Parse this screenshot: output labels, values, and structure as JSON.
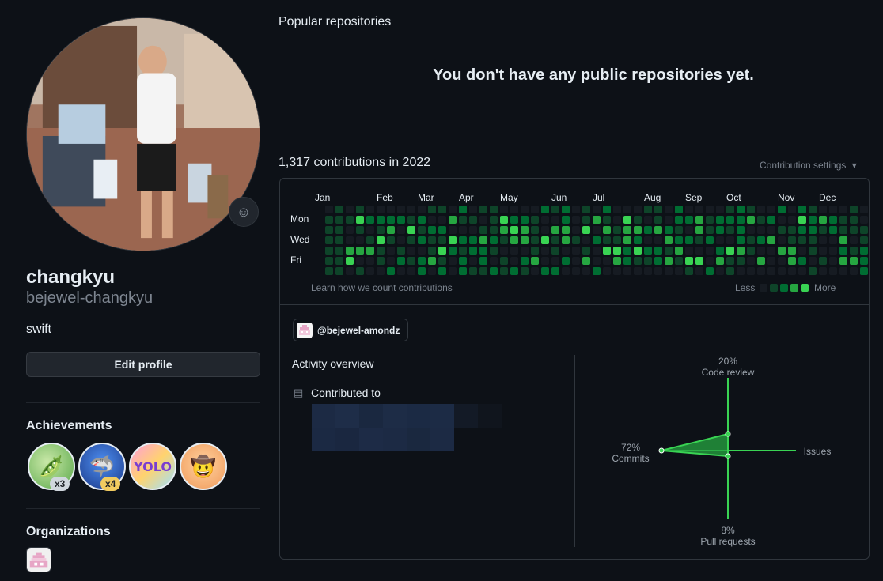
{
  "profile": {
    "name": "changkyu",
    "login": "bejewel-changkyu",
    "bio": "swift",
    "edit_label": "Edit profile",
    "status_icon": "smiley-icon"
  },
  "achievements": {
    "title": "Achievements",
    "badges": [
      {
        "icon": "pair-extraordinaire-icon",
        "count": "x3"
      },
      {
        "icon": "shark-icon",
        "count": "x4"
      },
      {
        "icon": "yolo-icon",
        "count": ""
      },
      {
        "icon": "cowboy-icon",
        "count": ""
      }
    ]
  },
  "organizations": {
    "title": "Organizations"
  },
  "repositories": {
    "title": "Popular repositories",
    "empty_message": "You don't have any public repositories yet."
  },
  "contributions": {
    "title": "1,317 contributions in 2022",
    "settings_label": "Contribution settings",
    "months": [
      "Jan",
      "Feb",
      "Mar",
      "Apr",
      "May",
      "Jun",
      "Jul",
      "Aug",
      "Sep",
      "Oct",
      "Nov",
      "Dec"
    ],
    "days": [
      "Mon",
      "Wed",
      "Fri"
    ],
    "learn_label": "Learn how we count contributions",
    "legend_less": "Less",
    "legend_more": "More",
    "level_colors": [
      "#161b22",
      "#0e4429",
      "#006d32",
      "#26a641",
      "#39d353"
    ]
  },
  "activity": {
    "org_chip": "@bejewel-amondz",
    "title": "Activity overview",
    "contributed_label": "Contributed to",
    "radar": {
      "code_review": {
        "pct": "20%",
        "label": "Code review"
      },
      "commits": {
        "pct": "72%",
        "label": "Commits"
      },
      "issues": {
        "pct": "",
        "label": "Issues"
      },
      "pull_requests": {
        "pct": "8%",
        "label": "Pull requests"
      }
    }
  }
}
